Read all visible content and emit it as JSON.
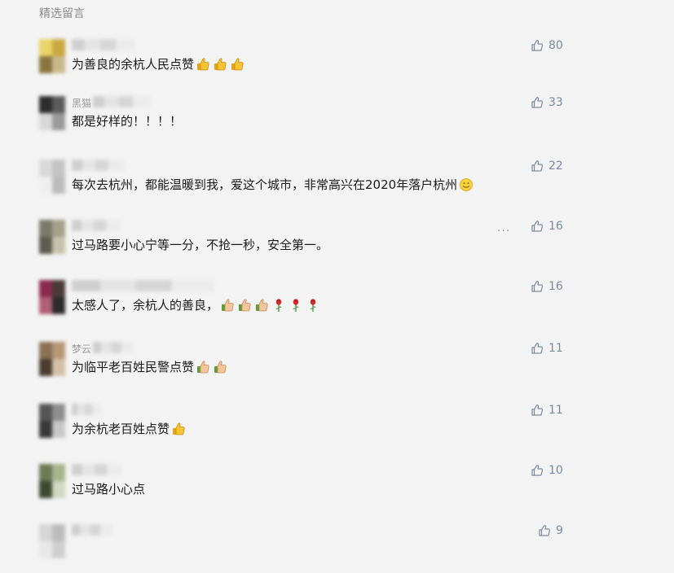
{
  "section": {
    "title": "精选留言"
  },
  "comments": [
    {
      "nickname": "",
      "text": "为善良的余杭人民点赞",
      "likes": "80",
      "emojis": [
        "thumbs-up-icon",
        "thumbs-up-icon",
        "thumbs-up-icon"
      ],
      "avatar_colors": [
        "#e9d36a",
        "#caa840",
        "#8a7540",
        "#c9b88a"
      ]
    },
    {
      "nickname": "黑猫",
      "text": "都是好样的！！！！",
      "likes": "33",
      "emojis": [],
      "avatar_colors": [
        "#2d2d2d",
        "#5c5c5c",
        "#d8d8d8",
        "#9a9a9a"
      ]
    },
    {
      "nickname": "",
      "text": "每次去杭州，都能温暖到我，爱这个城市，非常高兴在2020年落户杭州",
      "likes": "22",
      "emojis": [
        "slightly-smiling-face-icon"
      ],
      "avatar_colors": [
        "#d9d9d9",
        "#c4c4c4",
        "#eeeeee",
        "#bcbcbc"
      ]
    },
    {
      "nickname": "",
      "text": "过马路要小心宁等一分，不抢一秒，安全第一。",
      "likes": "16",
      "emojis": [],
      "avatar_colors": [
        "#7a7a6a",
        "#a5a08a",
        "#5c5c50",
        "#c7c2ad"
      ]
    },
    {
      "nickname": "",
      "text": "太感人了，余杭人的善良，",
      "likes": "16",
      "emojis": [
        "thumbs-up-light-icon",
        "thumbs-up-light-icon",
        "thumbs-up-light-icon",
        "rose-icon",
        "rose-icon",
        "rose-icon"
      ],
      "avatar_colors": [
        "#8b2a4e",
        "#4b3a3a",
        "#b06078",
        "#2c2c2c"
      ]
    },
    {
      "nickname": "梦云",
      "text": "为临平老百姓民警点赞",
      "likes": "11",
      "emojis": [
        "thumbs-up-light-icon",
        "thumbs-up-light-icon"
      ],
      "avatar_colors": [
        "#8a7055",
        "#b59675",
        "#4c3d30",
        "#d2c0a8"
      ]
    },
    {
      "nickname": "",
      "text": "为余杭老百姓点赞",
      "likes": "11",
      "emojis": [
        "thumbs-up-icon"
      ],
      "avatar_colors": [
        "#555555",
        "#8e8e8e",
        "#3a3a3a",
        "#c7c7c7"
      ]
    },
    {
      "nickname": "",
      "text": "过马路小心点",
      "likes": "10",
      "emojis": [],
      "avatar_colors": [
        "#6d7a55",
        "#a7b48d",
        "#3f4a32",
        "#d2d7c2"
      ]
    },
    {
      "nickname": "",
      "text": "",
      "likes": "9",
      "emojis": [],
      "avatar_colors": [
        "#d6d6d6",
        "#bdbdbd",
        "#e8e8e8",
        "#cfcfcf"
      ]
    }
  ],
  "more_label": "···",
  "colors": {
    "page_bg": "#f3f3f3",
    "like_color": "#7b8aa0",
    "muted": "#8a8a8a"
  }
}
